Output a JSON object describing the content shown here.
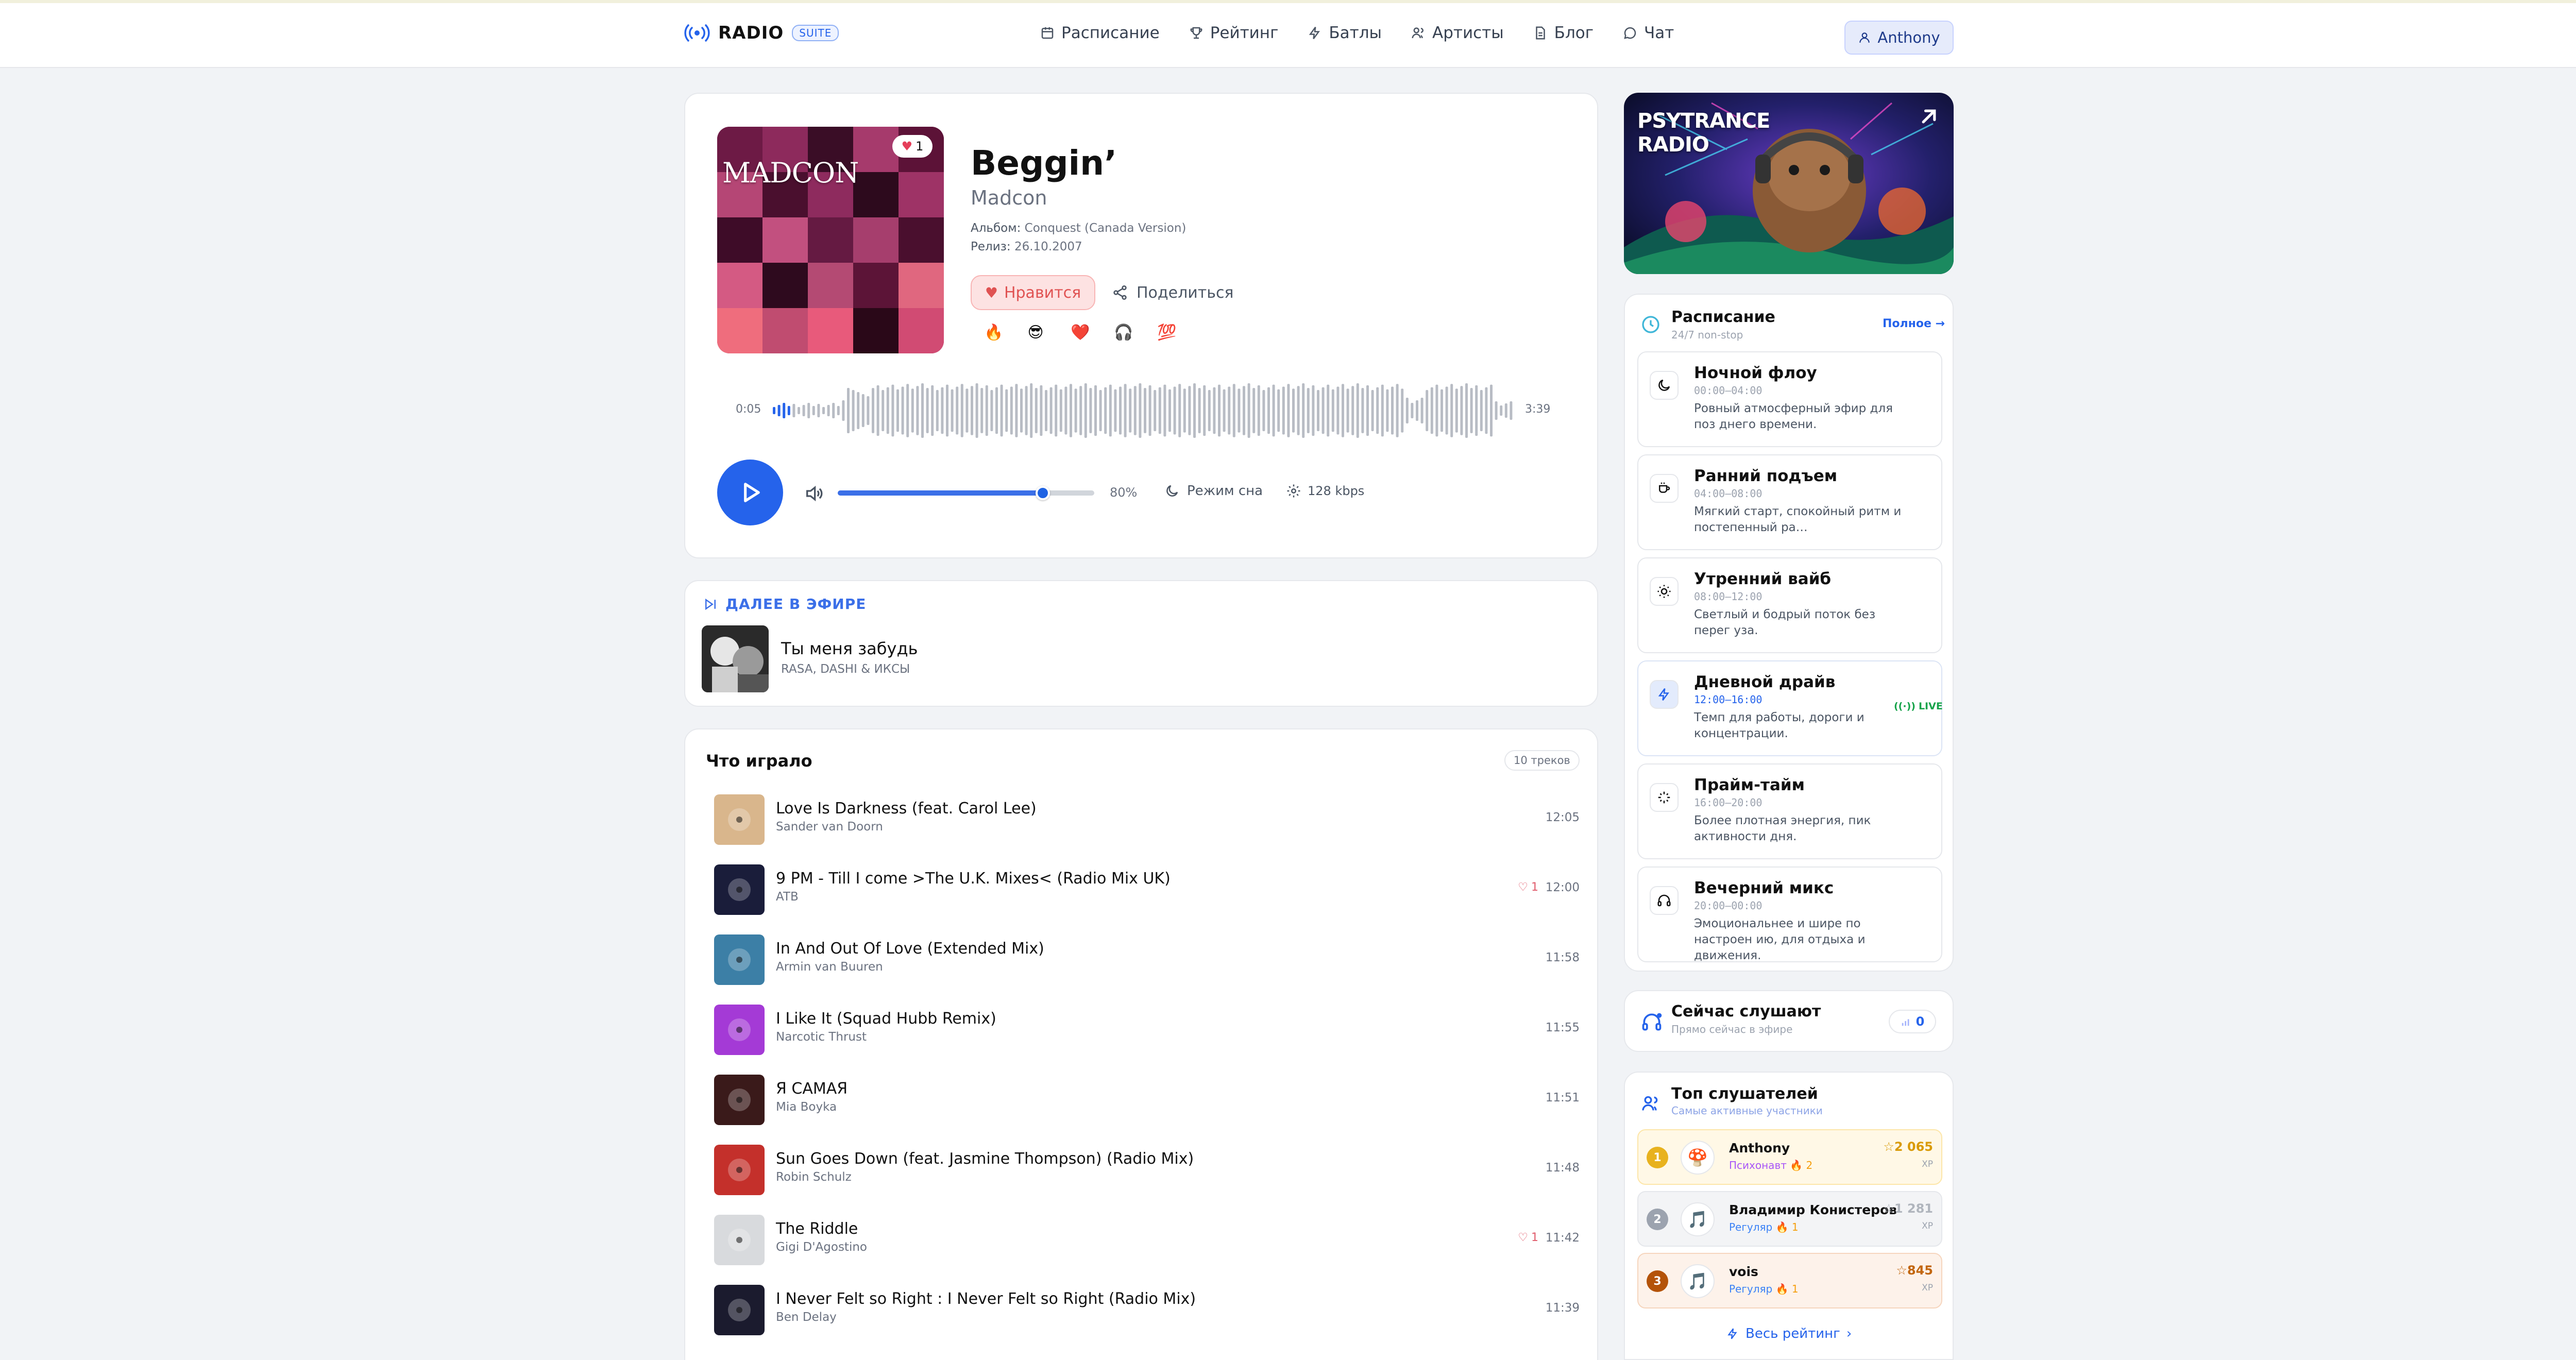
{
  "header": {
    "brand": "RADIO",
    "suite": "SUITE",
    "nav": [
      {
        "label": "Расписание",
        "icon": "calendar-icon"
      },
      {
        "label": "Рейтинг",
        "icon": "trophy-icon"
      },
      {
        "label": "Батлы",
        "icon": "bolt-icon"
      },
      {
        "label": "Артисты",
        "icon": "users-icon"
      },
      {
        "label": "Блог",
        "icon": "document-icon"
      },
      {
        "label": "Чат",
        "icon": "chat-icon"
      }
    ],
    "user": "Anthony"
  },
  "player": {
    "cover_text": "MADCON",
    "cover_likes": "1",
    "title": "Beggin’",
    "artist": "Madcon",
    "album_label": "Альбом:",
    "album": "Conquest (Canada Version)",
    "release_label": "Релиз:",
    "release": "26.10.2007",
    "like_label": "Нравится",
    "share_label": "Поделиться",
    "reactions": [
      "🔥",
      "😎",
      "❤️",
      "🎧",
      "💯"
    ],
    "time_elapsed": "0:05",
    "time_total": "3:39",
    "progress": 0.023,
    "volume_pct": "80%",
    "volume": 0.8,
    "sleep_label": "Режим сна",
    "bitrate": "128 kbps"
  },
  "next": {
    "label": "ДАЛЕЕ В ЭФИРЕ",
    "title": "Ты меня забудь",
    "artist": "RASA, DASHI & ИКСЫ"
  },
  "history": {
    "title": "Что играло",
    "count": "10 треков",
    "items": [
      {
        "title": "Love Is Darkness (feat. Carol Lee)",
        "artist": "Sander van Doorn",
        "time": "12:05",
        "likes": "",
        "color": "#d9b68c"
      },
      {
        "title": "9 PM - Till I come >The U.K. Mixes< (Radio Mix UK)",
        "artist": "ATB",
        "time": "12:00",
        "likes": "1",
        "color": "#1a1d3a"
      },
      {
        "title": "In And Out Of Love (Extended Mix)",
        "artist": "Armin van Buuren",
        "time": "11:58",
        "likes": "",
        "color": "#3c7fa6"
      },
      {
        "title": "I Like It (Squad Hubb Remix)",
        "artist": "Narcotic Thrust",
        "time": "11:55",
        "likes": "",
        "color": "#a43ad6"
      },
      {
        "title": "Я САМАЯ",
        "artist": "Mia Boyka",
        "time": "11:51",
        "likes": "",
        "color": "#3a1a1a"
      },
      {
        "title": "Sun Goes Down (feat. Jasmine Thompson) (Radio Mix)",
        "artist": "Robin Schulz",
        "time": "11:48",
        "likes": "",
        "color": "#c4302b"
      },
      {
        "title": "The Riddle",
        "artist": "Gigi D'Agostino",
        "time": "11:42",
        "likes": "1",
        "color": "#d8dadd"
      },
      {
        "title": "I Never Felt so Right : I Never Felt so Right (Radio Mix)",
        "artist": "Ben Delay",
        "time": "11:39",
        "likes": "",
        "color": "#1b1b2e"
      }
    ]
  },
  "banner": {
    "line1": "PSYTRANCE",
    "line2": "RADIO"
  },
  "schedule": {
    "title": "Расписание",
    "subtitle": "24/7 non-stop",
    "full_link": "Полное →",
    "live_label": "LIVE",
    "slots": [
      {
        "name": "Ночной флоу",
        "time": "00:00–04:00",
        "desc": "Ровный атмосферный эфир для поз днего времени.",
        "icon": "moon-icon"
      },
      {
        "name": "Ранний подъем",
        "time": "04:00–08:00",
        "desc": "Мягкий старт, спокойный ритм и постепенный ра…",
        "icon": "coffee-icon"
      },
      {
        "name": "Утренний вайб",
        "time": "08:00–12:00",
        "desc": "Светлый и бодрый поток без перег уза.",
        "icon": "sun-icon"
      },
      {
        "name": "Дневной драйв",
        "time": "12:00–16:00",
        "desc": "Темп для работы, дороги и концентрации.",
        "icon": "bolt-icon"
      },
      {
        "name": "Прайм-тайм",
        "time": "16:00–20:00",
        "desc": "Более плотная энергия, пик активности дня.",
        "icon": "sparkles-icon"
      },
      {
        "name": "Вечерний микс",
        "time": "20:00–00:00",
        "desc": "Эмоциональнее и шире по настроен ию, для отдыха и движения.",
        "icon": "headphones-icon"
      }
    ]
  },
  "listeners": {
    "title": "Сейчас слушают",
    "subtitle": "Прямо сейчас в эфире",
    "count": "0"
  },
  "top": {
    "title": "Топ слушателей",
    "subtitle": "Самые активные участники",
    "xp_unit": "XP",
    "all_link": "Весь рейтинг",
    "users": [
      {
        "rank": "1",
        "name": "Anthony",
        "level": "Психонавт",
        "streak": "🔥 2",
        "xp": "☆2 065",
        "avatar": "🍄"
      },
      {
        "rank": "2",
        "name": "Владимир Конистеров",
        "level": "Регуляр",
        "streak": "🔥 1",
        "xp": "☆1 281",
        "avatar": "🎵"
      },
      {
        "rank": "3",
        "name": "vois",
        "level": "Регуляр",
        "streak": "🔥 1",
        "xp": "☆845",
        "avatar": "🎵"
      }
    ]
  }
}
